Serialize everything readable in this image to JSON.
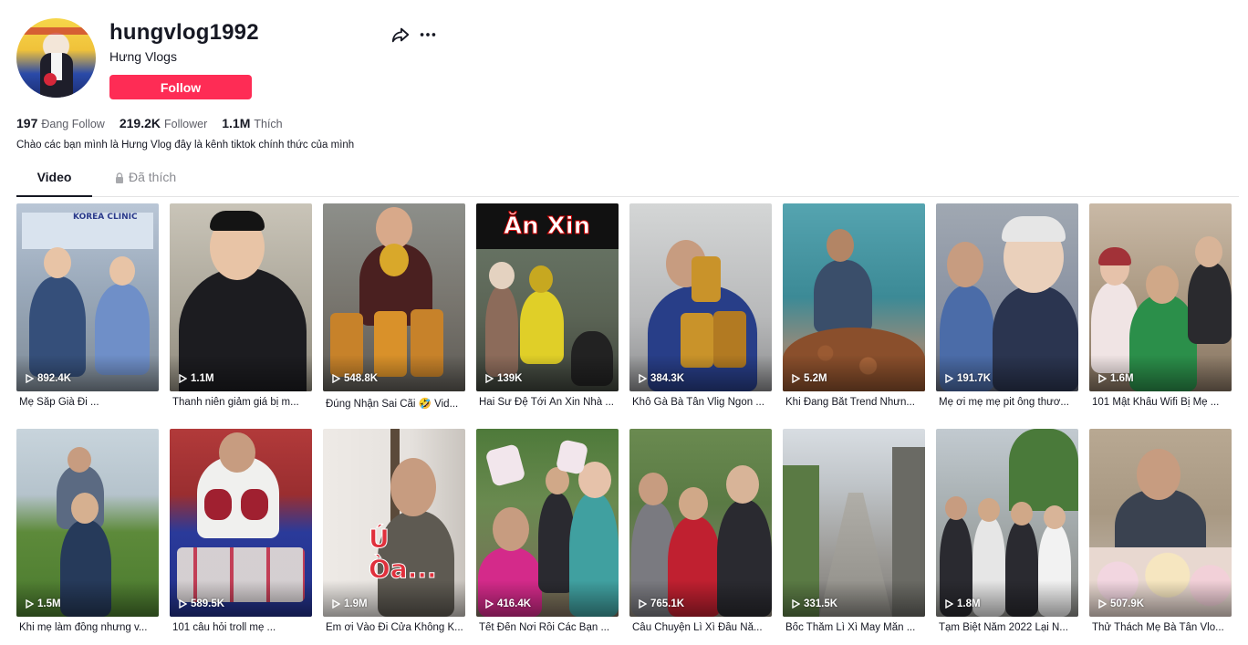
{
  "profile": {
    "username": "hungvlog1992",
    "nickname": "Hưng Vlogs",
    "follow_label": "Follow",
    "bio": "Chào các bạn mình là Hưng Vlog đây là kênh tiktok chính thức của mình"
  },
  "stats": [
    {
      "value": "197",
      "label": "Đang Follow"
    },
    {
      "value": "219.2K",
      "label": "Follower"
    },
    {
      "value": "1.1M",
      "label": "Thích"
    }
  ],
  "tabs": {
    "video": "Video",
    "liked": "Đã thích"
  },
  "icons": {
    "share": "share-arrow-icon",
    "more": "more-dots-icon",
    "lock": "lock-icon",
    "play": "play-icon"
  },
  "colors": {
    "follow": "#fe2c55",
    "text": "#161823",
    "muted": "#8a8b91"
  },
  "thumb_texts": {
    "clinic": "KOREA CLINIC",
    "an_xin": "Ăn Xin",
    "u_oa": "Ú Òa..."
  },
  "videos": [
    {
      "views": "892.4K",
      "caption": "Mẹ Sắp Già Đi ..."
    },
    {
      "views": "1.1M",
      "caption": "Thanh niên giảm giá bị m..."
    },
    {
      "views": "548.8K",
      "caption": "Đúng Nhận Sai Cãi 🤣 Vid..."
    },
    {
      "views": "139K",
      "caption": "Hai Sư Đệ Tới Ăn Xin Nhà ..."
    },
    {
      "views": "384.3K",
      "caption": "Khô Gà Bà Tân Vlig Ngon ..."
    },
    {
      "views": "5.2M",
      "caption": "Khi Đang Bắt Trend Nhưn..."
    },
    {
      "views": "191.7K",
      "caption": "Mẹ ơi mẹ mẹ pit ông thươ..."
    },
    {
      "views": "1.6M",
      "caption": "101 Mật Khẩu Wifi Bị Mẹ ..."
    },
    {
      "views": "1.5M",
      "caption": "Khi mẹ làm đồng nhưng v..."
    },
    {
      "views": "589.5K",
      "caption": "101 câu hỏi troll mẹ ..."
    },
    {
      "views": "1.9M",
      "caption": "Em ơi Vào Đi Cửa Không K..."
    },
    {
      "views": "416.4K",
      "caption": "Tết Đến Nơi Rồi Các Bạn ..."
    },
    {
      "views": "765.1K",
      "caption": "Câu Chuyện Lì Xì Đầu Nă..."
    },
    {
      "views": "331.5K",
      "caption": "Bốc Thăm Lì Xì May Mắn ..."
    },
    {
      "views": "1.8M",
      "caption": "Tạm Biệt Năm 2022 Lại N..."
    },
    {
      "views": "507.9K",
      "caption": "Thử Thách Mẹ Bà Tân Vlo..."
    }
  ]
}
